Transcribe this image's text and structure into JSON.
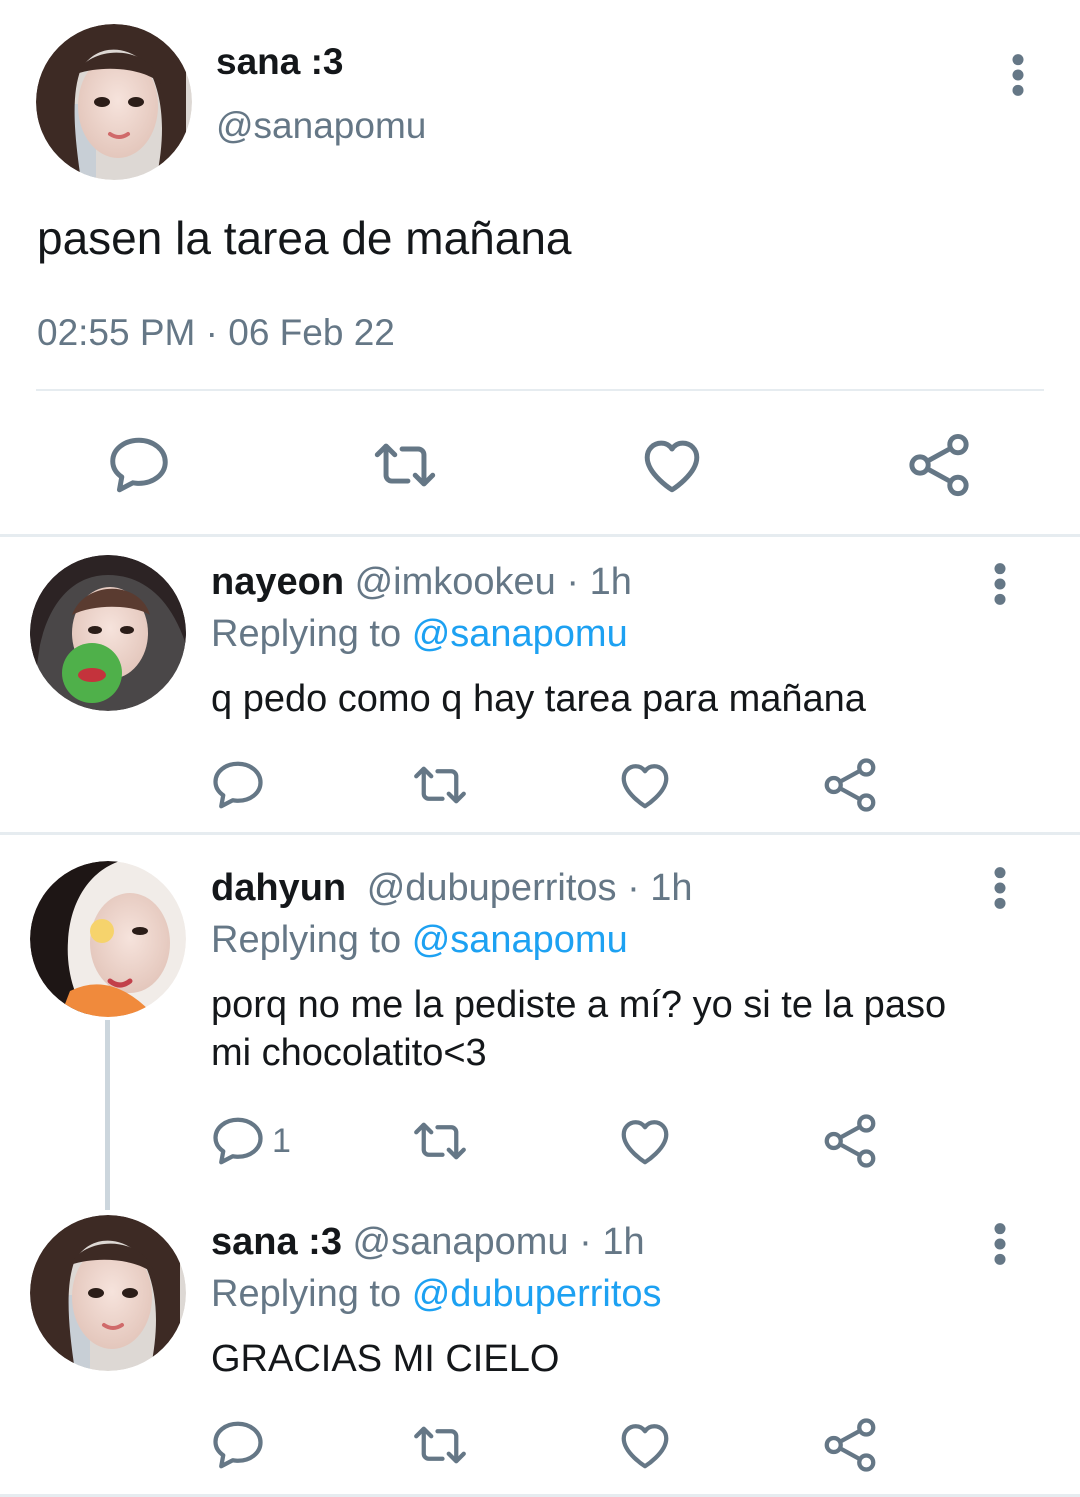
{
  "colors": {
    "name": "#14171a",
    "secondary": "#657786",
    "link": "#1da1f2",
    "divider": "#e6ecf0",
    "icon": "#657786",
    "thread_line": "#ccd6dd"
  },
  "main_tweet": {
    "display_name": "sana :3",
    "handle": "@sanapomu",
    "text": "pasen la tarea de mañana",
    "timestamp": "02:55 PM · 06 Feb 22",
    "actions": [
      "reply-icon",
      "retweet-icon",
      "like-icon",
      "share-icon"
    ]
  },
  "replies": [
    {
      "display_name": "nayeon",
      "handle": "@imkookeu",
      "dot": "·",
      "time": "1h",
      "replying_prefix": "Replying to",
      "replying_to": "@sanapomu",
      "text": "q pedo como q hay tarea para mañana",
      "reply_count": ""
    },
    {
      "display_name": "dahyun",
      "handle": "@dubuperritos",
      "dot": "·",
      "time": "1h",
      "replying_prefix": "Replying to",
      "replying_to": "@sanapomu",
      "text": "porq no me la pediste a mí? yo si te la paso mi chocolatito<3",
      "reply_count": "1"
    },
    {
      "display_name": "sana :3",
      "handle": "@sanapomu",
      "dot": "·",
      "time": "1h",
      "replying_prefix": "Replying to",
      "replying_to": "@dubuperritos",
      "text": "GRACIAS MI CIELO",
      "reply_count": ""
    }
  ]
}
